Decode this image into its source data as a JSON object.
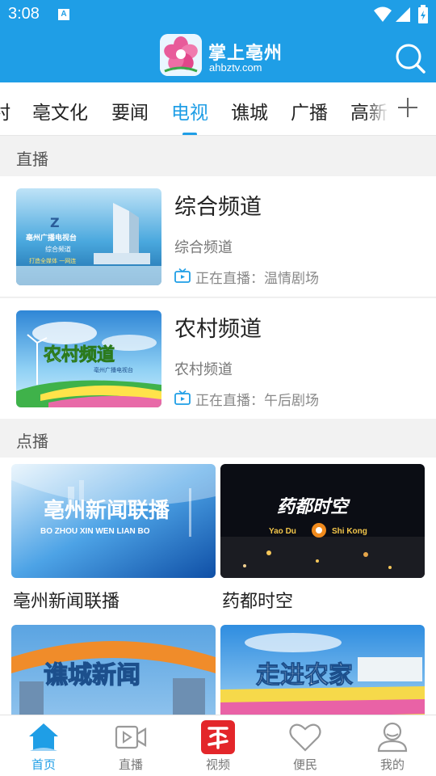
{
  "status_bar": {
    "time": "3:08",
    "notification_glyph": "A"
  },
  "app_bar": {
    "title": "掌上亳州",
    "url": "ahbztv.com"
  },
  "tabs": [
    {
      "label": "村"
    },
    {
      "label": "亳文化"
    },
    {
      "label": "要闻"
    },
    {
      "label": "电视",
      "active": true
    },
    {
      "label": "谯城"
    },
    {
      "label": "广播"
    },
    {
      "label": "高新"
    }
  ],
  "live_section": {
    "title": "直播"
  },
  "live_channels": [
    {
      "title": "综合频道",
      "subtitle": "综合频道",
      "now_playing": "正在直播：温情剧场",
      "thumb_text": {
        "line1": "亳州广播电视台",
        "line2": "综合频道",
        "line3": "打造全媒体 一网连"
      }
    },
    {
      "title": "农村频道",
      "subtitle": "农村频道",
      "now_playing": "正在直播：午后剧场",
      "thumb_text": {
        "line1": "农村频道",
        "line2": "亳州广播电视台"
      }
    }
  ],
  "vod_section": {
    "title": "点播"
  },
  "vod_items": [
    {
      "title": "亳州新闻联播",
      "thumb_text": "亳州新闻联播",
      "thumb_sub": "BO ZHOU XIN WEN LIAN BO"
    },
    {
      "title": "药都时空",
      "thumb_text": "药都时空",
      "thumb_sub_left": "Yao Du",
      "thumb_sub_right": "Shi Kong"
    },
    {
      "title": "",
      "thumb_text": "谯城新闻"
    },
    {
      "title": "",
      "thumb_text": "走进农家"
    }
  ],
  "bottom_nav": [
    {
      "label": "首页",
      "icon": "home-icon",
      "active": true
    },
    {
      "label": "直播",
      "icon": "video-camera-icon"
    },
    {
      "label": "视频",
      "icon": "video-logo-icon"
    },
    {
      "label": "便民",
      "icon": "heart-icon"
    },
    {
      "label": "我的",
      "icon": "user-icon"
    }
  ],
  "colors": {
    "accent": "#1f9ee6",
    "header_bg": "#1f9ee6",
    "text_primary": "#222222",
    "text_secondary": "#777777"
  }
}
